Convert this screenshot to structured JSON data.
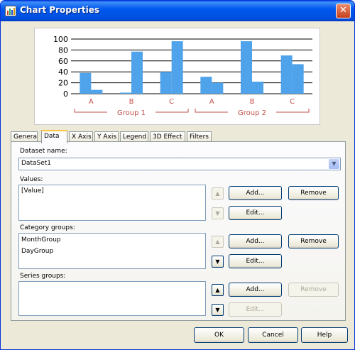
{
  "window": {
    "title": "Chart Properties",
    "close_glyph": "✕"
  },
  "chart_data": {
    "type": "bar",
    "categories": [
      "A",
      "B",
      "C",
      "A",
      "B",
      "C"
    ],
    "groups": [
      {
        "label": "Group 1",
        "categories": [
          "A",
          "B",
          "C"
        ]
      },
      {
        "label": "Group 2",
        "categories": [
          "A",
          "B",
          "C"
        ]
      }
    ],
    "series": [
      {
        "values": [
          38,
          2,
          40,
          31,
          96,
          70
        ]
      },
      {
        "values": [
          7,
          77,
          96,
          20,
          22,
          54
        ]
      }
    ],
    "yticks": [
      "0",
      "20",
      "40",
      "60",
      "80",
      "100"
    ],
    "ylim": [
      0,
      100
    ],
    "grid": true,
    "bar_color": "#4fa3ea"
  },
  "tabs": [
    "General",
    "Data",
    "X Axis",
    "Y Axis",
    "Legend",
    "3D Effect",
    "Filters"
  ],
  "active_tab": "Data",
  "dataset": {
    "label": "Dataset name:",
    "value": "DataSet1"
  },
  "values_section": {
    "label": "Values:",
    "items": [
      "[Value]"
    ]
  },
  "category_groups": {
    "label": "Category groups:",
    "items": [
      "MonthGroup",
      "DayGroup"
    ]
  },
  "series_groups": {
    "label": "Series groups:",
    "items": []
  },
  "buttons": {
    "add": "Add...",
    "remove": "Remove",
    "edit": "Edit...",
    "ok": "OK",
    "cancel": "Cancel",
    "help": "Help"
  },
  "icons": {
    "up": "▲",
    "down": "▼",
    "combo_arrow": "▼"
  }
}
